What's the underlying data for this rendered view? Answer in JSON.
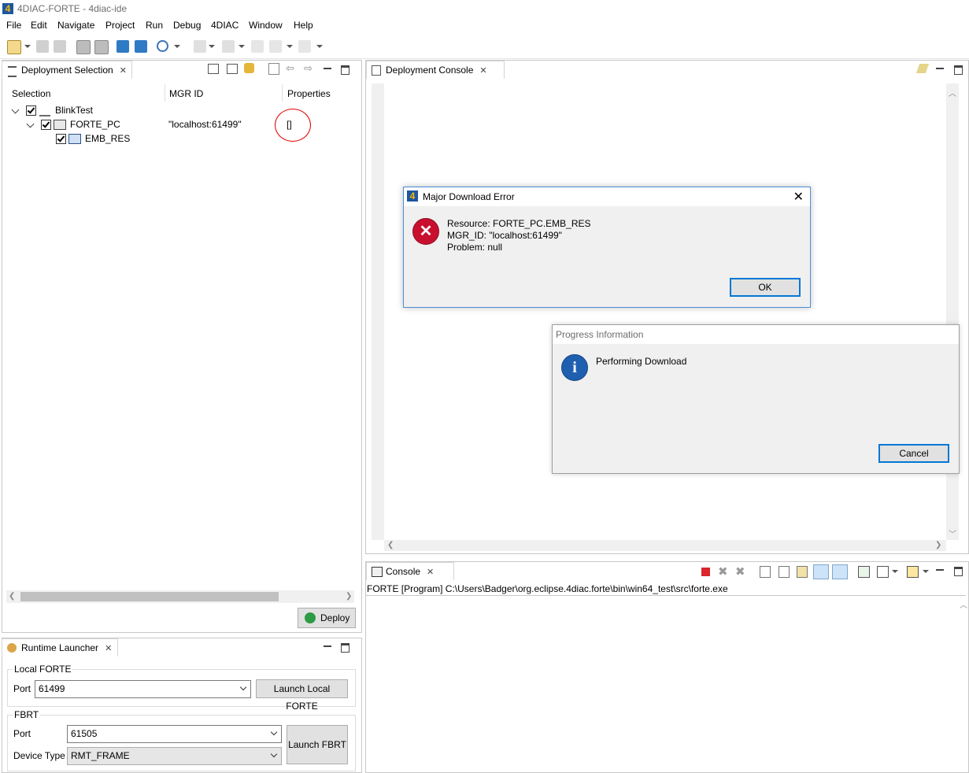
{
  "window": {
    "title": "4DIAC-FORTE - 4diac-ide"
  },
  "menu": [
    "File",
    "Edit",
    "Navigate",
    "Project",
    "Run",
    "Debug",
    "4DIAC",
    "Window",
    "Help"
  ],
  "deployment_selection": {
    "tab_title": "Deployment Selection",
    "columns": [
      "Selection",
      "MGR ID",
      "Properties"
    ],
    "rows": [
      {
        "name": "BlinkTest",
        "mgr_id": "",
        "properties": ""
      },
      {
        "name": "FORTE_PC",
        "mgr_id": "\"localhost:61499\"",
        "properties": "[]"
      },
      {
        "name": "EMB_RES",
        "mgr_id": "",
        "properties": ""
      }
    ],
    "deploy_label": "Deploy"
  },
  "deployment_console": {
    "tab_title": "Deployment Console"
  },
  "error_dialog": {
    "title": "Major Download Error",
    "lines": [
      "Resource: FORTE_PC.EMB_RES",
      "MGR_ID: \"localhost:61499\"",
      "Problem: null"
    ],
    "ok_label": "OK"
  },
  "progress_dialog": {
    "title": "Progress Information",
    "message": "Performing Download",
    "cancel_label": "Cancel"
  },
  "console": {
    "tab_title": "Console",
    "process_line": "FORTE [Program] C:\\Users\\Badger\\org.eclipse.4diac.forte\\bin\\win64_test\\src\\forte.exe"
  },
  "runtime_launcher": {
    "tab_title": "Runtime Launcher",
    "local_forte": {
      "group_label": "Local FORTE",
      "port_label": "Port",
      "port_value": "61499",
      "launch_label": "Launch Local FORTE"
    },
    "fbrt": {
      "group_label": "FBRT",
      "port_label": "Port",
      "port_value": "61505",
      "device_type_label": "Device Type",
      "device_type_value": "RMT_FRAME",
      "launch_label": "Launch FBRT"
    }
  },
  "colors": {
    "accent": "#0078d7",
    "error_red": "#c8102e",
    "info_blue": "#1f5fb0",
    "annotation_red": "#e00000"
  }
}
